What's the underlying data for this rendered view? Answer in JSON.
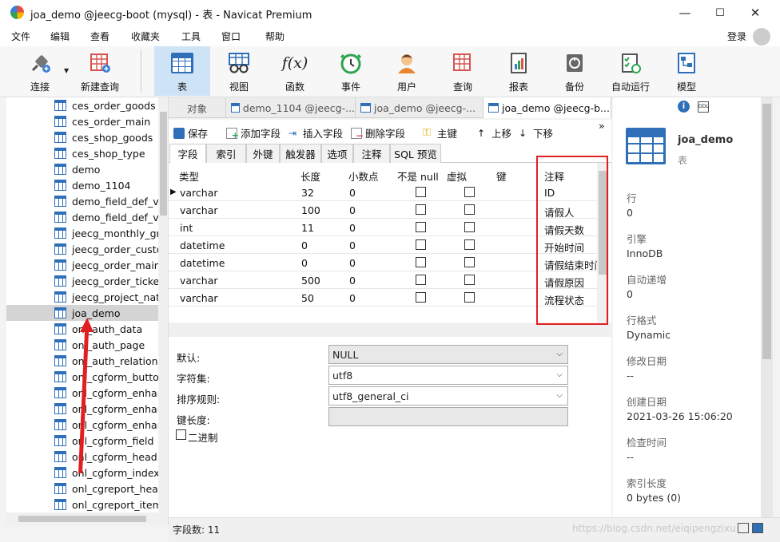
{
  "window": {
    "title": "joa_demo @jeecg-boot (mysql) - 表 - Navicat Premium",
    "controls": {
      "minimize": "—",
      "maximize": "☐",
      "close": "✕"
    }
  },
  "menu": {
    "items": [
      "文件",
      "编辑",
      "查看",
      "收藏夹",
      "工具",
      "窗口",
      "帮助"
    ],
    "login": "登录"
  },
  "toolbar": {
    "items": [
      {
        "label": "连接",
        "icon": "plug-icon"
      },
      {
        "label": "新建查询",
        "icon": "new-query-icon"
      },
      {
        "label": "表",
        "icon": "table-icon"
      },
      {
        "label": "视图",
        "icon": "view-icon"
      },
      {
        "label": "函数",
        "icon": "function-icon",
        "glyph": "f(x)"
      },
      {
        "label": "事件",
        "icon": "clock-icon"
      },
      {
        "label": "用户",
        "icon": "user-icon"
      },
      {
        "label": "查询",
        "icon": "query-icon"
      },
      {
        "label": "报表",
        "icon": "report-icon"
      },
      {
        "label": "备份",
        "icon": "backup-icon"
      },
      {
        "label": "自动运行",
        "icon": "automation-icon"
      },
      {
        "label": "模型",
        "icon": "model-icon"
      }
    ]
  },
  "tree": {
    "items": [
      "ces_order_goods",
      "ces_order_main",
      "ces_shop_goods",
      "ces_shop_type",
      "demo",
      "demo_1104",
      "demo_field_def_va",
      "demo_field_def_va",
      "jeecg_monthly_gr",
      "jeecg_order_custo",
      "jeecg_order_main",
      "jeecg_order_ticke",
      "jeecg_project_nat",
      "joa_demo",
      "onl_auth_data",
      "onl_auth_page",
      "onl_auth_relation",
      "onl_cgform_butto",
      "onl_cgform_enhar",
      "onl_cgform_enhar",
      "onl_cgform_enhar",
      "onl_cgform_field",
      "onl_cgform_head",
      "onl_cgform_index",
      "onl_cgreport_hea",
      "onl_cgreport_item"
    ],
    "selected": "joa_demo"
  },
  "tabs": {
    "object": "对象",
    "items": [
      "demo_1104 @jeecg-...",
      "joa_demo @jeecg-...",
      "joa_demo @jeecg-b..."
    ]
  },
  "actions": {
    "save": "保存",
    "add_field": "添加字段",
    "insert_field": "插入字段",
    "delete_field": "删除字段",
    "primary_key": "主键",
    "move_up": "上移",
    "move_down": "下移",
    "more": "»"
  },
  "subtabs": [
    "字段",
    "索引",
    "外键",
    "触发器",
    "选项",
    "注释",
    "SQL 预览"
  ],
  "grid": {
    "headers": {
      "type": "类型",
      "length": "长度",
      "decimal": "小数点",
      "not_null": "不是 null",
      "virtual": "虚拟",
      "key": "键",
      "comment": "注释"
    },
    "rows": [
      {
        "type": "varchar",
        "length": "32",
        "decimal": "0",
        "comment": "ID"
      },
      {
        "type": "varchar",
        "length": "100",
        "decimal": "0",
        "comment": "请假人"
      },
      {
        "type": "int",
        "length": "11",
        "decimal": "0",
        "comment": "请假天数"
      },
      {
        "type": "datetime",
        "length": "0",
        "decimal": "0",
        "comment": "开始时间"
      },
      {
        "type": "datetime",
        "length": "0",
        "decimal": "0",
        "comment": "请假结束时间"
      },
      {
        "type": "varchar",
        "length": "500",
        "decimal": "0",
        "comment": "请假原因"
      },
      {
        "type": "varchar",
        "length": "50",
        "decimal": "0",
        "comment": "流程状态"
      }
    ],
    "row_marker": "▶"
  },
  "props": {
    "default_label": "默认:",
    "default_value": "NULL",
    "charset_label": "字符集:",
    "charset_value": "utf8",
    "collation_label": "排序规则:",
    "collation_value": "utf8_general_ci",
    "keylen_label": "键长度:",
    "binary_label": "二进制"
  },
  "status": {
    "field_count": "字段数: 11",
    "watermark": "https://blog.csdn.net/eiqipengzixu"
  },
  "info": {
    "name": "joa_demo",
    "type": "表",
    "fields": [
      {
        "label": "行",
        "value": "0"
      },
      {
        "label": "引擎",
        "value": "InnoDB"
      },
      {
        "label": "自动递增",
        "value": "0"
      },
      {
        "label": "行格式",
        "value": "Dynamic"
      },
      {
        "label": "修改日期",
        "value": "--"
      },
      {
        "label": "创建日期",
        "value": "2021-03-26 15:06:20"
      },
      {
        "label": "检查时间",
        "value": "--"
      },
      {
        "label": "索引长度",
        "value": "0 bytes (0)"
      }
    ]
  },
  "colors": {
    "accent": "#2f6fb8",
    "highlight_box": "#e02020",
    "selected_tool": "#cfe3f7"
  }
}
